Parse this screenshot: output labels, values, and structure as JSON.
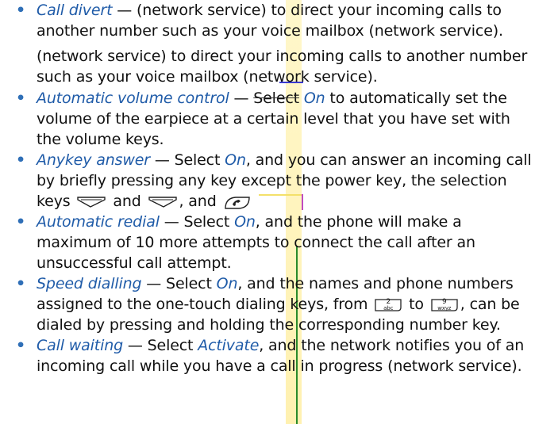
{
  "items": [
    {
      "term": "Call divert",
      "sep": " — ",
      "text1": "(network service) to direct your incoming calls to",
      "text2": "another number such as your voice mailbox (network service)."
    },
    {
      "repeat1": "(network service) to direct your incoming calls to another number",
      "repeat2": "such as your voice mailbox (network service)."
    },
    {
      "term": "Automatic volume control",
      "sep": " — ",
      "select": "Select",
      "opt": "On",
      "text1": " to automatically set the",
      "text2": "volume of the earpiece at a certain level that you have set with",
      "text3": "the volume keys."
    },
    {
      "term": "Anykey answer",
      "sep": " — Select ",
      "opt": "On",
      "text1": ", and you can answer an incoming call",
      "text2": "by briefly pressing any key except the power key, the selection",
      "text3a": "keys",
      "text3b": "and",
      "text3c": ", and",
      ".": "."
    },
    {
      "term": "Automatic redial",
      "sep": " — Select ",
      "opt": "On",
      "text1": ", and the phone will make a",
      "text2": "maximum of 10 more attempts to connect the call after an",
      "text3": "unsuccessful call attempt."
    },
    {
      "term": "Speed dialling",
      "sep": " — Select ",
      "opt": "On",
      "text1": ", and the names and phone numbers",
      "text2a": "assigned to the one-touch dialing keys, from",
      "text2b": "to",
      "text2c": ", can be",
      "text3": "dialed by pressing and holding the corresponding number key.",
      "key2": "2",
      "key2sub": "abc",
      "key9": "9",
      "key9sub": "wxyz"
    },
    {
      "term": "Call waiting",
      "sep": " — Select ",
      "opt": "Activate",
      "text1": ", and the network notifies you of an",
      "text2": "incoming call while you have a call in progress (network service)."
    }
  ],
  "bullet": "•",
  "colors": {
    "term": "#1f5ba8",
    "bullet": "#2f6fb7",
    "text": "#111111",
    "highlight": "#fff3b0"
  },
  "icons": [
    "left-selection-key-icon",
    "right-selection-key-icon",
    "call-key-icon",
    "key-2-icon",
    "key-9-icon"
  ]
}
